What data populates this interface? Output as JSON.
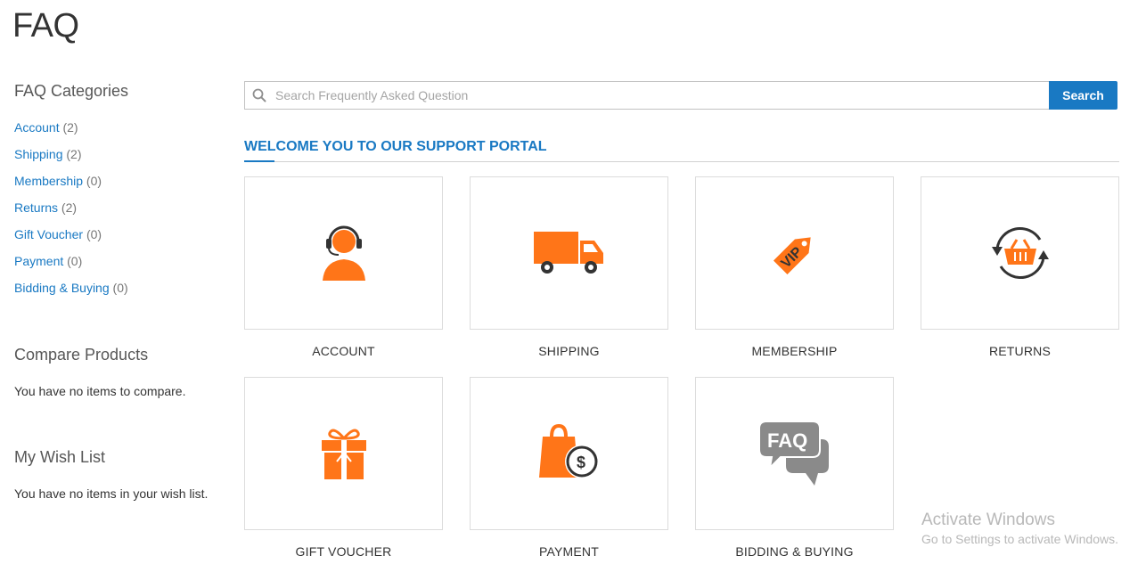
{
  "page": {
    "title": "FAQ"
  },
  "sidebar": {
    "categories_title": "FAQ Categories",
    "categories": [
      {
        "label": "Account",
        "count": "(2)"
      },
      {
        "label": "Shipping",
        "count": "(2)"
      },
      {
        "label": "Membership",
        "count": "(0)"
      },
      {
        "label": "Returns",
        "count": "(2)"
      },
      {
        "label": "Gift Voucher",
        "count": "(0)"
      },
      {
        "label": "Payment",
        "count": "(0)"
      },
      {
        "label": "Bidding & Buying",
        "count": "(0)"
      }
    ],
    "compare": {
      "title": "Compare Products",
      "empty": "You have no items to compare."
    },
    "wishlist": {
      "title": "My Wish List",
      "empty": "You have no items in your wish list."
    }
  },
  "search": {
    "placeholder": "Search Frequently Asked Question",
    "value": "",
    "button_label": "Search"
  },
  "portal": {
    "heading": "WELCOME YOU TO OUR SUPPORT PORTAL"
  },
  "tiles": [
    {
      "label": "ACCOUNT",
      "icon": "headset-agent-icon"
    },
    {
      "label": "SHIPPING",
      "icon": "delivery-truck-icon"
    },
    {
      "label": "MEMBERSHIP",
      "icon": "vip-tag-icon"
    },
    {
      "label": "RETURNS",
      "icon": "basket-return-icon"
    },
    {
      "label": "GIFT VOUCHER",
      "icon": "gift-box-icon"
    },
    {
      "label": "PAYMENT",
      "icon": "shopping-bag-dollar-icon"
    },
    {
      "label": "BIDDING & BUYING",
      "icon": "faq-chat-bubble-icon"
    }
  ],
  "colors": {
    "accent": "#1979c3",
    "icon_orange": "#ff7518",
    "icon_dark": "#333333",
    "icon_gray": "#8a8a8a"
  },
  "watermark": {
    "title": "Activate Windows",
    "subtitle": "Go to Settings to activate Windows."
  }
}
